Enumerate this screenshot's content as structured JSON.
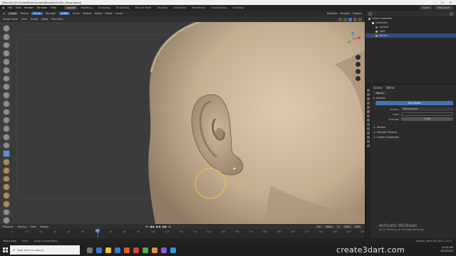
{
  "titlebar": {
    "title": "[Blender] [E:\\CreateStar\\Content\\Blender\\03-Ear_Temp.blend]",
    "minimize": "–",
    "maximize": "☐",
    "close": "✕"
  },
  "menu": [
    "File",
    "Edit",
    "Render",
    "Window",
    "Help"
  ],
  "workspace_tabs": [
    "Layout",
    "Modeling",
    "Sculpting",
    "UV Editing",
    "Texture Paint",
    "Shading",
    "Animation",
    "Rendering",
    "Compositing",
    "Scripting"
  ],
  "active_workspace": "Layout",
  "scene": {
    "scene_name": "Scene",
    "view_layer": "View Layer"
  },
  "tool_header": {
    "brush": "Crab",
    "radius_label": "Radius",
    "radius_value": "50 px",
    "strength_label": "Strength",
    "strength_value": "0.500",
    "brush_menu": "Brush",
    "texture_menu": "Texture",
    "stroke_menu": "Stroke",
    "falloff_menu": "Falloff",
    "cursor_menu": "Cursor",
    "dyntopo": "Dyntopo",
    "remesh": "Remesh",
    "options": "Options"
  },
  "view_header": {
    "mode": "Sculpt Mode",
    "view": "View",
    "sculpt": "Sculpt",
    "mask": "Mask",
    "face_sets": "Face Sets"
  },
  "timeline": {
    "menus": [
      "Playback",
      "Keying",
      "View",
      "Marker"
    ],
    "controls": [
      "⏮",
      "◀◀",
      "◀",
      "▶",
      "▶▶",
      "⏭"
    ],
    "current_frame": "32",
    "start_label": "Start",
    "start": "1",
    "end_label": "End",
    "end": "250",
    "ticks": [
      "0",
      "10",
      "20",
      "30",
      "40",
      "50",
      "60",
      "70",
      "80",
      "90",
      "100",
      "110",
      "120",
      "130",
      "140",
      "150",
      "160",
      "170",
      "180",
      "190",
      "200",
      "210",
      "220",
      "230",
      "240",
      "250"
    ]
  },
  "status": {
    "left": "Rotate View",
    "middle": "Move",
    "right_hint": "Sculpt Context Menu",
    "stats": "Sphere | Verts:291,842 | 2.91.0"
  },
  "outliner": {
    "header": "Scene Collection",
    "rows": [
      {
        "label": "Scene Collection",
        "icon": "collection-icon"
      },
      {
        "label": "Collection",
        "icon": "collection-icon"
      },
      {
        "label": "Camera",
        "icon": "camera-icon"
      },
      {
        "label": "Light",
        "icon": "light-icon"
      },
      {
        "label": "Sphere",
        "icon": "mesh-icon",
        "selected": true
      }
    ]
  },
  "properties": {
    "tab_scene": "Scene",
    "tab_world": "World",
    "world_name": "World",
    "surface_section": "Surface",
    "use_nodes": "Use Nodes",
    "surface_label": "Surface",
    "surface_value": "Background",
    "color_label": "Color",
    "strength_label": "Strength",
    "strength_value": "1.000",
    "sections": [
      "Volume",
      "Viewport Display",
      "Custom Properties"
    ]
  },
  "activation": {
    "title": "Activate Windows",
    "subtitle": "Go to Settings to activate Windows."
  },
  "taskbar": {
    "search_placeholder": "Type here to search",
    "time": "12:02 AM",
    "date": "8/15/2020"
  },
  "watermark": "create3dart.com",
  "colors": {
    "accent": "#4772b3",
    "skin": "#c9b59b",
    "background": "#3a3a3a"
  }
}
